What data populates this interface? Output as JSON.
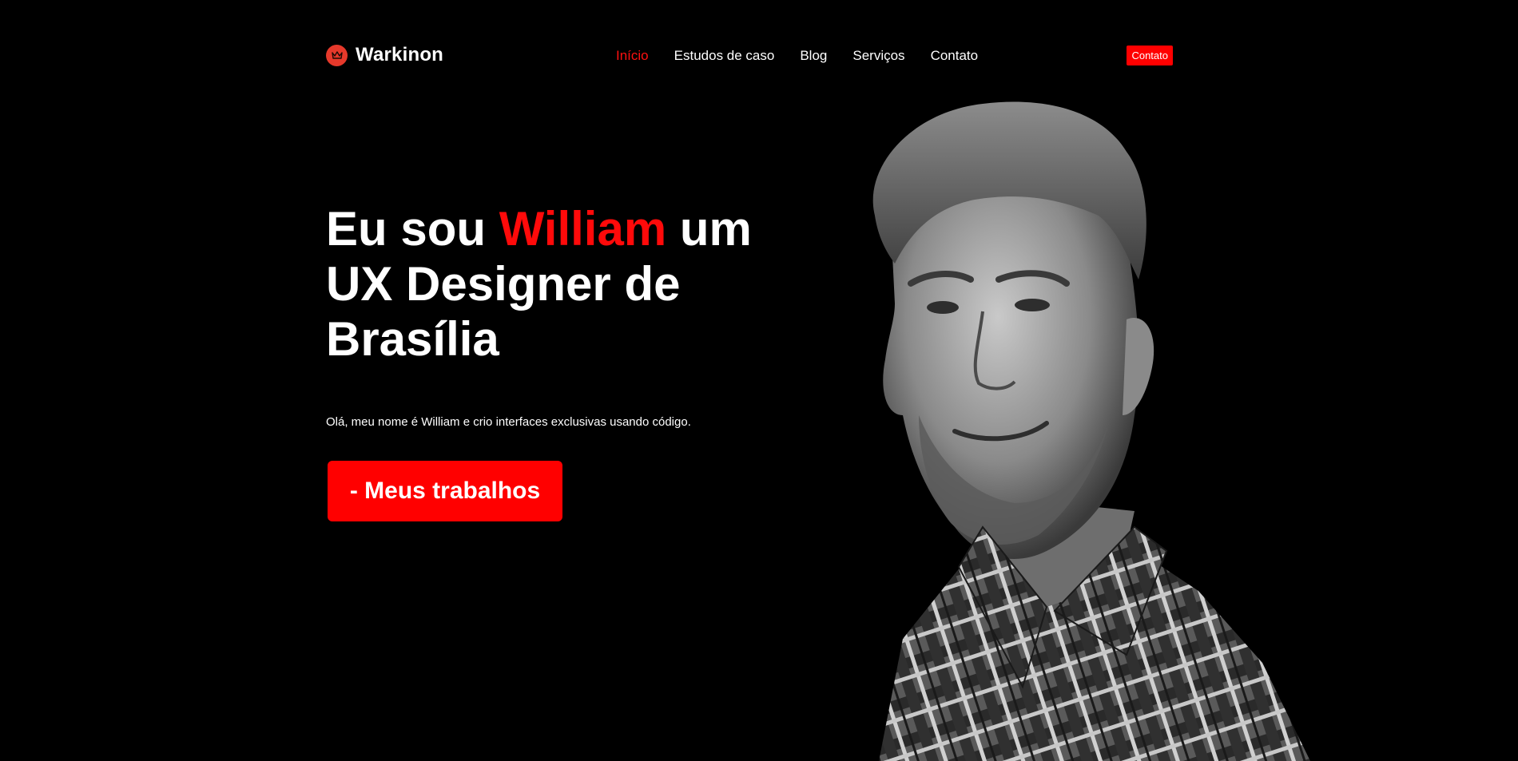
{
  "brand": {
    "name": "Warkinon",
    "icon": "crown-icon",
    "accent": "#e6392b"
  },
  "nav": {
    "items": [
      {
        "label": "Início",
        "active": true
      },
      {
        "label": "Estudos de caso",
        "active": false
      },
      {
        "label": "Blog",
        "active": false
      },
      {
        "label": "Serviços",
        "active": false
      },
      {
        "label": "Contato",
        "active": false
      }
    ],
    "cta_label": "Contato"
  },
  "hero": {
    "title_prefix": "Eu sou ",
    "title_highlight": "William",
    "title_suffix": " um UX Designer de Brasília",
    "subtitle": "Olá, meu nome é William e crio interfaces exclusivas usando código.",
    "button_label": "- Meus trabalhos"
  },
  "colors": {
    "background": "#000000",
    "accent": "#ff0000",
    "text": "#ffffff"
  }
}
